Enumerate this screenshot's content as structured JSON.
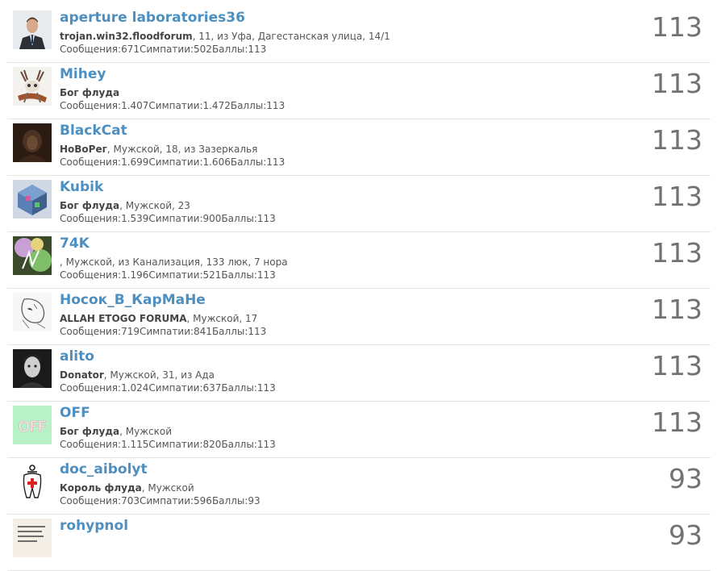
{
  "members": [
    {
      "name": "aperture laboratories36",
      "title": "trojan.win32.floodforum",
      "details": ", 11, из Уфа, Дагестанская улица, 14/1",
      "messages_label": "Сообщения:",
      "messages": "671",
      "likes_label": "Симпатии:",
      "likes": "502",
      "points_label": "Баллы:",
      "points": "113",
      "score": "113",
      "avatar": "man-in-suit-avatar"
    },
    {
      "name": "Mihey",
      "title": "Бог флуда",
      "details": "",
      "messages_label": "Сообщения:",
      "messages": "1.407",
      "likes_label": "Симпатии:",
      "likes": "1.472",
      "points_label": "Баллы:",
      "points": "113",
      "score": "113",
      "avatar": "deer-skull-avatar"
    },
    {
      "name": "BlackCat",
      "title": "НоВоРег",
      "details": ", Мужской, 18, из Зазеркалья",
      "messages_label": "Сообщения:",
      "messages": "1.699",
      "likes_label": "Симпатии:",
      "likes": "1.606",
      "points_label": "Баллы:",
      "points": "113",
      "score": "113",
      "avatar": "dark-portrait-avatar"
    },
    {
      "name": "Kubik",
      "title": "Бог флуда",
      "details": ", Мужской, 23",
      "messages_label": "Сообщения:",
      "messages": "1.539",
      "likes_label": "Симпатии:",
      "likes": "900",
      "points_label": "Баллы:",
      "points": "113",
      "score": "113",
      "avatar": "cube-avatar"
    },
    {
      "name": "74K",
      "title": "",
      "details": ", Мужской, из Канализация, 133 люк, 7 нора",
      "messages_label": "Сообщения:",
      "messages": "1.196",
      "likes_label": "Симпатии:",
      "likes": "521",
      "points_label": "Баллы:",
      "points": "113",
      "score": "113",
      "avatar": "colorful-abstract-avatar"
    },
    {
      "name": "Носок_В_КарМаНе",
      "title": "ALLAH ETOGO FORUMA",
      "details": ", Мужской, 17",
      "messages_label": "Сообщения:",
      "messages": "719",
      "likes_label": "Симпатии:",
      "likes": "841",
      "points_label": "Баллы:",
      "points": "113",
      "score": "113",
      "avatar": "sketch-avatar"
    },
    {
      "name": "alito",
      "title": "Donator",
      "details": ", Мужской, 31, из Ада",
      "messages_label": "Сообщения:",
      "messages": "1.024",
      "likes_label": "Симпатии:",
      "likes": "637",
      "points_label": "Баллы:",
      "points": "113",
      "score": "113",
      "avatar": "bw-portrait-avatar"
    },
    {
      "name": "OFF",
      "title": "Бог флуда",
      "details": ", Мужской",
      "messages_label": "Сообщения:",
      "messages": "1.115",
      "likes_label": "Симпатии:",
      "likes": "820",
      "points_label": "Баллы:",
      "points": "113",
      "score": "113",
      "avatar": "off-text-avatar"
    },
    {
      "name": "doc_aibolyt",
      "title": "Король флуда",
      "details": ", Мужской",
      "messages_label": "Сообщения:",
      "messages": "703",
      "likes_label": "Симпатии:",
      "likes": "596",
      "points_label": "Баллы:",
      "points": "93",
      "score": "93",
      "avatar": "tooth-avatar"
    },
    {
      "name": "rohypnol",
      "title": "",
      "details": "",
      "messages_label": "",
      "messages": "",
      "likes_label": "",
      "likes": "",
      "points_label": "",
      "points": "",
      "score": "93",
      "avatar": "text-note-avatar"
    }
  ]
}
